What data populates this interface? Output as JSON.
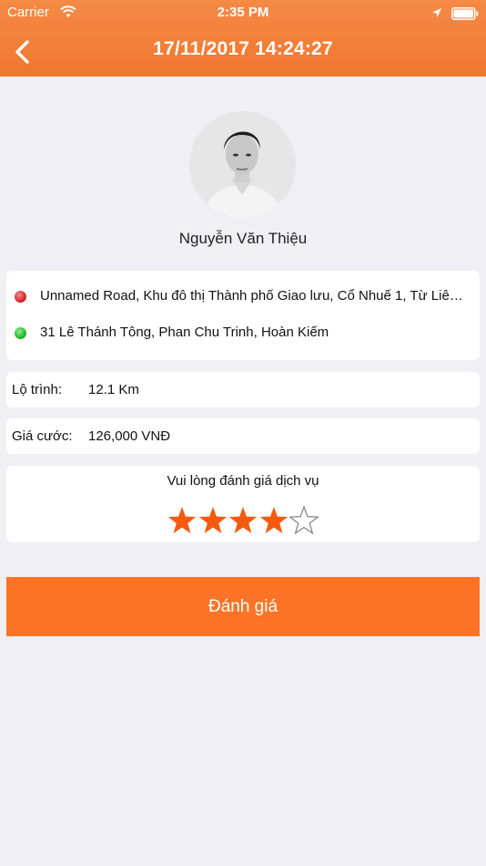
{
  "status_bar": {
    "carrier": "Carrier",
    "time": "2:35 PM"
  },
  "nav": {
    "title": "17/11/2017 14:24:27"
  },
  "driver": {
    "name": "Nguyễn Văn Thiệu"
  },
  "route": {
    "pickup": "Unnamed Road, Khu đô thị Thành phố Giao lưu, Cổ Nhuế 1, Từ Liêm, Hà Nội",
    "dropoff": "31 Lê Thánh Tông, Phan Chu Trinh, Hoàn Kiếm"
  },
  "trip": {
    "distance_label": "Lộ trình:",
    "distance_value": "12.1 Km",
    "fare_label": "Giá cước:",
    "fare_value": "126,000 VNĐ"
  },
  "rating": {
    "prompt": "Vui lòng đánh giá dịch vụ",
    "value": 4,
    "max": 5
  },
  "submit": {
    "label": "Đánh giá"
  },
  "colors": {
    "accent": "#fd7427",
    "header": "#f0772f",
    "background": "#efeff4",
    "star_filled": "#f55a0f"
  }
}
